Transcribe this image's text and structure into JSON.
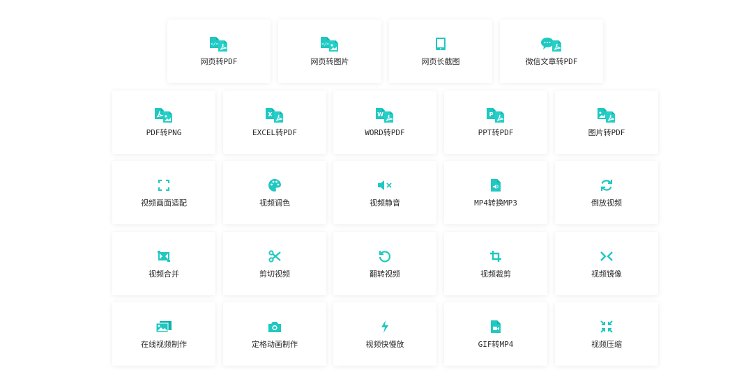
{
  "theme": {
    "icon_color": "#1fc8c1",
    "icon_color_dark": "#0fb3ac",
    "text_color": "#2b2b2b"
  },
  "row1": [
    {
      "label": "网页转PDF",
      "icon": "html-to-pdf-icon"
    },
    {
      "label": "网页转图片",
      "icon": "html-to-image-icon"
    },
    {
      "label": "网页长截图",
      "icon": "tablet-screenshot-icon"
    },
    {
      "label": "微信文章转PDF",
      "icon": "wechat-to-pdf-icon"
    }
  ],
  "row2": [
    {
      "label": "PDF转PNG",
      "icon": "pdf-to-png-icon"
    },
    {
      "label": "EXCEL转PDF",
      "icon": "excel-to-pdf-icon"
    },
    {
      "label": "WORD转PDF",
      "icon": "word-to-pdf-icon"
    },
    {
      "label": "PPT转PDF",
      "icon": "ppt-to-pdf-icon"
    },
    {
      "label": "图片转PDF",
      "icon": "image-to-pdf-icon"
    }
  ],
  "row3": [
    {
      "label": "视频画面适配",
      "icon": "fullscreen-icon"
    },
    {
      "label": "视频调色",
      "icon": "palette-icon"
    },
    {
      "label": "视频静音",
      "icon": "mute-icon"
    },
    {
      "label": "MP4转换MP3",
      "icon": "audio-file-icon"
    },
    {
      "label": "倒放视频",
      "icon": "refresh-icon"
    }
  ],
  "row4": [
    {
      "label": "视频合并",
      "icon": "merge-icon"
    },
    {
      "label": "剪切视频",
      "icon": "scissors-icon"
    },
    {
      "label": "翻转视频",
      "icon": "rotate-icon"
    },
    {
      "label": "视频裁剪",
      "icon": "crop-icon"
    },
    {
      "label": "视频镜像",
      "icon": "mirror-icon"
    }
  ],
  "row5": [
    {
      "label": "在线视频制作",
      "icon": "image-gallery-icon"
    },
    {
      "label": "定格动画制作",
      "icon": "camera-icon"
    },
    {
      "label": "视频快慢放",
      "icon": "lightning-icon"
    },
    {
      "label": "GIF转MP4",
      "icon": "video-file-icon"
    },
    {
      "label": "视频压缩",
      "icon": "compress-icon"
    }
  ]
}
